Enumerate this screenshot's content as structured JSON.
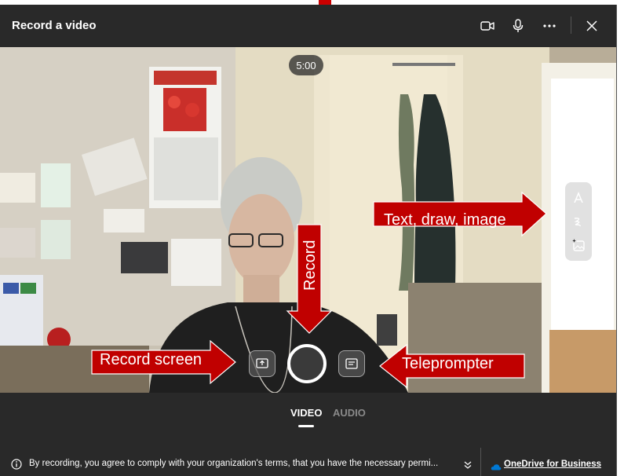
{
  "window": {
    "title": "Record a video"
  },
  "header_icons": [
    "camera-icon",
    "microphone-icon",
    "more-icon",
    "close-icon"
  ],
  "recording": {
    "timer": "5:00"
  },
  "tools": [
    "text-icon",
    "draw-icon",
    "image-icon"
  ],
  "annotations": {
    "text_draw_image": "Text, draw, image",
    "record": "Record",
    "record_screen": "Record screen",
    "teleprompter": "Teleprompter"
  },
  "tabs": [
    {
      "label": "VIDEO",
      "active": true
    },
    {
      "label": "AUDIO",
      "active": false
    }
  ],
  "footer": {
    "disclaimer": "By recording, you agree to comply with your organization's terms, that you have the necessary permi...",
    "onedrive_link": "OneDrive for Business"
  },
  "colors": {
    "dialog_bg": "#292929",
    "callout_red": "#c00000",
    "accent_blue": "#0078d4"
  }
}
